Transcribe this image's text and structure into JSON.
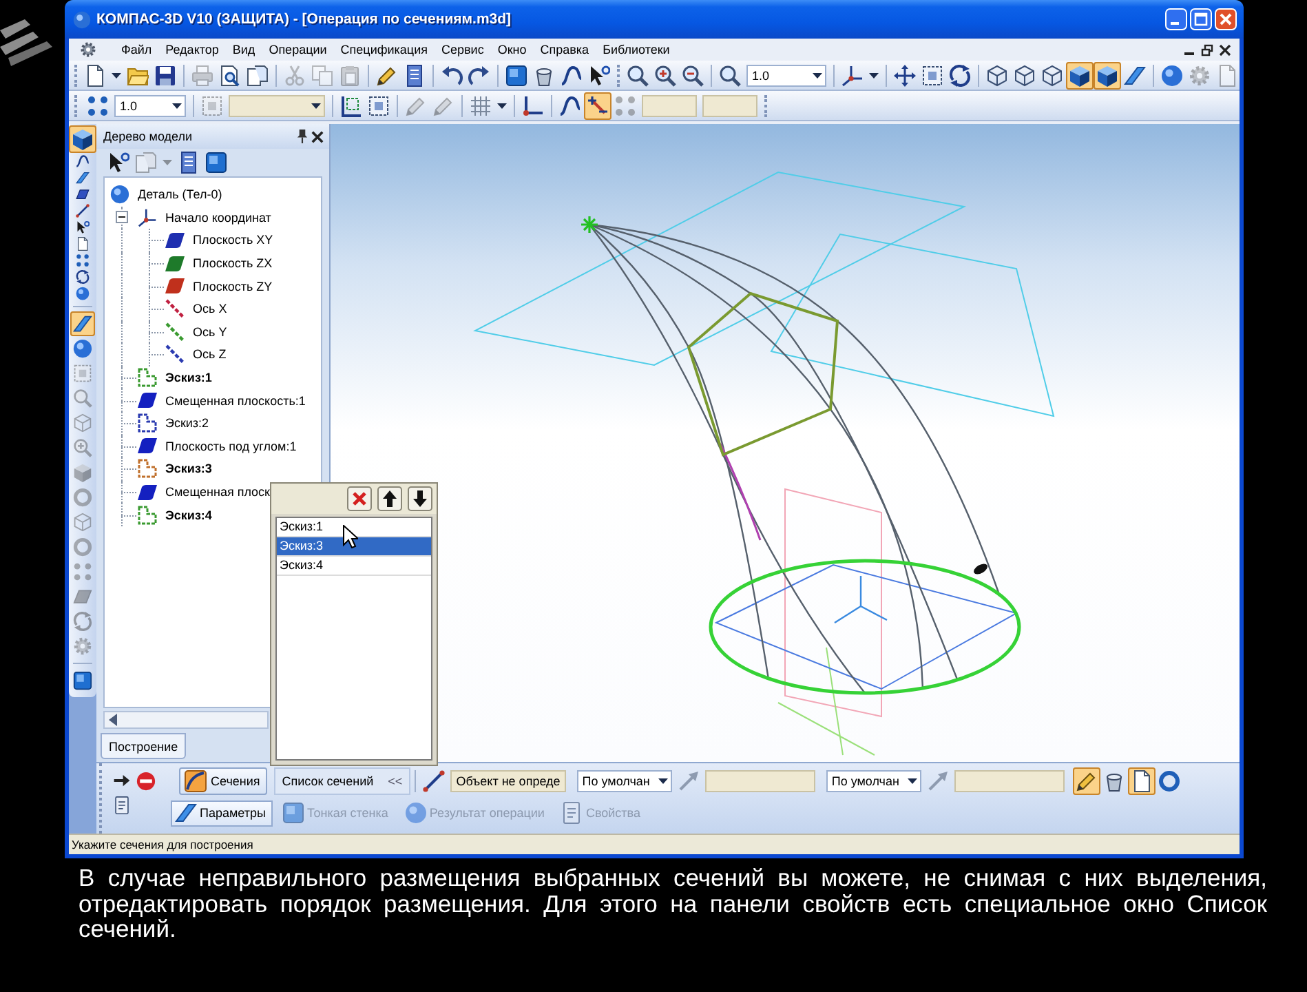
{
  "window": {
    "title": "КОМПАС-3D V10 (ЗАЩИТА) - [Операция по сечениям.m3d]"
  },
  "menu": [
    "Файл",
    "Редактор",
    "Вид",
    "Операции",
    "Спецификация",
    "Сервис",
    "Окно",
    "Справка",
    "Библиотеки"
  ],
  "toolbar_1": {
    "buttons": [
      {
        "selected": false,
        "disabled": false
      },
      {
        "selected": false,
        "disabled": false
      },
      {
        "selected": false,
        "disabled": false
      },
      {
        "selected": false,
        "disabled": false
      },
      {
        "selected": false,
        "disabled": true
      },
      {
        "selected": false,
        "disabled": false
      },
      {
        "selected": false,
        "disabled": false
      },
      {
        "selected": false,
        "disabled": true
      },
      {
        "selected": false,
        "disabled": true
      },
      {
        "selected": false,
        "disabled": true
      },
      {
        "selected": false,
        "disabled": false
      },
      {
        "selected": false,
        "disabled": false
      },
      {
        "selected": false,
        "disabled": false
      },
      {
        "selected": false,
        "disabled": false
      },
      {
        "selected": false,
        "disabled": false
      },
      {
        "selected": false,
        "disabled": false
      },
      {
        "selected": false,
        "disabled": false
      },
      {
        "selected": false,
        "disabled": false
      },
      {
        "selected": false,
        "disabled": false
      },
      {
        "selected": false,
        "disabled": false
      },
      {
        "selected": false,
        "disabled": false
      },
      {
        "selected": false,
        "disabled": false
      },
      {
        "selected": false,
        "disabled": false
      },
      {
        "selected": false,
        "disabled": false
      },
      {
        "selected": false,
        "disabled": false
      },
      {
        "selected": false,
        "disabled": false
      },
      {
        "selected": false,
        "disabled": false
      },
      {
        "selected": false,
        "disabled": false
      },
      {
        "selected": false,
        "disabled": false
      },
      {
        "selected": false,
        "disabled": false
      },
      {
        "selected": true,
        "disabled": false
      },
      {
        "selected": true,
        "disabled": false
      },
      {
        "selected": false,
        "disabled": false
      },
      {
        "selected": false,
        "disabled": false
      },
      {
        "selected": false,
        "disabled": true
      },
      {
        "selected": false,
        "disabled": true
      }
    ],
    "scale": {
      "value": "1.0"
    }
  },
  "toolbar_2": {
    "buttons": [
      {
        "selected": false,
        "disabled": false
      },
      {
        "selected": false,
        "disabled": true
      },
      {
        "selected": false,
        "disabled": false
      },
      {
        "selected": false,
        "disabled": false
      },
      {
        "selected": false,
        "disabled": true
      },
      {
        "selected": false,
        "disabled": true
      },
      {
        "selected": false,
        "disabled": false
      },
      {
        "selected": false,
        "disabled": false
      },
      {
        "selected": false,
        "disabled": false
      },
      {
        "selected": false,
        "disabled": false
      },
      {
        "selected": true,
        "disabled": false
      },
      {
        "selected": false,
        "disabled": true
      }
    ],
    "scale": {
      "value": "1.0"
    }
  },
  "tool_palette": {
    "buttons": [
      {
        "selected": true,
        "disabled": false
      },
      {
        "selected": false,
        "disabled": false
      },
      {
        "selected": false,
        "disabled": false
      },
      {
        "selected": false,
        "disabled": false
      },
      {
        "selected": false,
        "disabled": false
      },
      {
        "selected": false,
        "disabled": false
      },
      {
        "selected": false,
        "disabled": false
      },
      {
        "selected": false,
        "disabled": false
      },
      {
        "selected": false,
        "disabled": false
      },
      {
        "selected": false,
        "disabled": false
      },
      {
        "selected": true,
        "disabled": false
      },
      {
        "selected": false,
        "disabled": false
      },
      {
        "selected": false,
        "disabled": true
      },
      {
        "selected": false,
        "disabled": true
      },
      {
        "selected": false,
        "disabled": true
      },
      {
        "selected": false,
        "disabled": true
      },
      {
        "selected": false,
        "disabled": true
      },
      {
        "selected": false,
        "disabled": true
      },
      {
        "selected": false,
        "disabled": true
      },
      {
        "selected": false,
        "disabled": true
      },
      {
        "selected": false,
        "disabled": true
      },
      {
        "selected": false,
        "disabled": true
      },
      {
        "selected": false,
        "disabled": true
      },
      {
        "selected": false,
        "disabled": true
      },
      {
        "selected": false,
        "disabled": false
      }
    ]
  },
  "model_tree": {
    "title": "Дерево модели",
    "toolbar": [
      {
        "selected": false,
        "disabled": false
      },
      {
        "selected": false,
        "disabled": true
      },
      {
        "selected": false,
        "disabled": true
      },
      {
        "selected": false,
        "disabled": false
      },
      {
        "selected": false,
        "disabled": false
      }
    ],
    "items": [
      {
        "label": "Деталь (Тел-0)",
        "kind": "part",
        "bold": false,
        "children": [
          {
            "label": "Начало координат",
            "kind": "origin",
            "bold": false,
            "expanded": true,
            "children": [
              {
                "label": "Плоскость XY",
                "kind": "plane",
                "bold": false,
                "color": "#1f2fb0"
              },
              {
                "label": "Плоскость ZX",
                "kind": "plane",
                "bold": false,
                "color": "#1e7a2a"
              },
              {
                "label": "Плоскость ZY",
                "kind": "plane",
                "bold": false,
                "color": "#c0301c"
              },
              {
                "label": "Ось X",
                "kind": "axis",
                "bold": false,
                "color": "#c02040"
              },
              {
                "label": "Ось Y",
                "kind": "axis",
                "bold": false,
                "color": "#3a9a30"
              },
              {
                "label": "Ось Z",
                "kind": "axis",
                "bold": false,
                "color": "#2a3ab0"
              }
            ]
          },
          {
            "label": "Эскиз:1",
            "kind": "sketch",
            "bold": true,
            "color": "#3a9a30"
          },
          {
            "label": "Смещенная плоскость:1",
            "kind": "plane",
            "bold": false,
            "color": "#1420c0"
          },
          {
            "label": "Эскиз:2",
            "kind": "sketch",
            "bold": false,
            "color": "#2a3ab0"
          },
          {
            "label": "Плоскость под углом:1",
            "kind": "plane",
            "bold": false,
            "color": "#1420c0"
          },
          {
            "label": "Эскиз:3",
            "kind": "sketch",
            "bold": true,
            "color": "#c0702c"
          },
          {
            "label": "Смещенная плоск",
            "kind": "plane",
            "bold": false,
            "color": "#1420c0"
          },
          {
            "label": "Эскиз:4",
            "kind": "sketch",
            "bold": true,
            "color": "#3a9a30"
          }
        ]
      }
    ],
    "tab": {
      "label": "Построение"
    }
  },
  "sections_list": {
    "items": [
      {
        "label": "Эскиз:1",
        "selected": false
      },
      {
        "label": "Эскиз:3",
        "selected": true
      },
      {
        "label": "Эскиз:4",
        "selected": false
      }
    ]
  },
  "property_panel": {
    "sections_button": {
      "label": "Сечения"
    },
    "list_toggle": {
      "label": "Список сечений",
      "arrow": "<<"
    },
    "object_field": {
      "value": "Объект не опреде"
    },
    "directions": [
      {
        "combo": "По умолчан"
      },
      {
        "combo": "По умолчан"
      }
    ],
    "buttons": [
      {
        "selected": true,
        "disabled": false
      },
      {
        "selected": false,
        "disabled": false
      },
      {
        "selected": true,
        "disabled": false
      },
      {
        "selected": false,
        "disabled": false
      }
    ],
    "tabs": [
      {
        "label": "Параметры",
        "selected": true,
        "disabled": false
      },
      {
        "label": "Тонкая стенка",
        "selected": false,
        "disabled": true
      },
      {
        "label": "Результат операции",
        "selected": false,
        "disabled": true
      },
      {
        "label": "Свойства",
        "selected": false,
        "disabled": true
      }
    ]
  },
  "status_bar": {
    "text": "Укажите сечения для построения"
  },
  "caption": "В случае неправильного размещения выбранных сечений вы можете, не снимая с них выделения, отредактировать порядок размещения. Для этого на панели свойств есть специальное окно Список сечений."
}
